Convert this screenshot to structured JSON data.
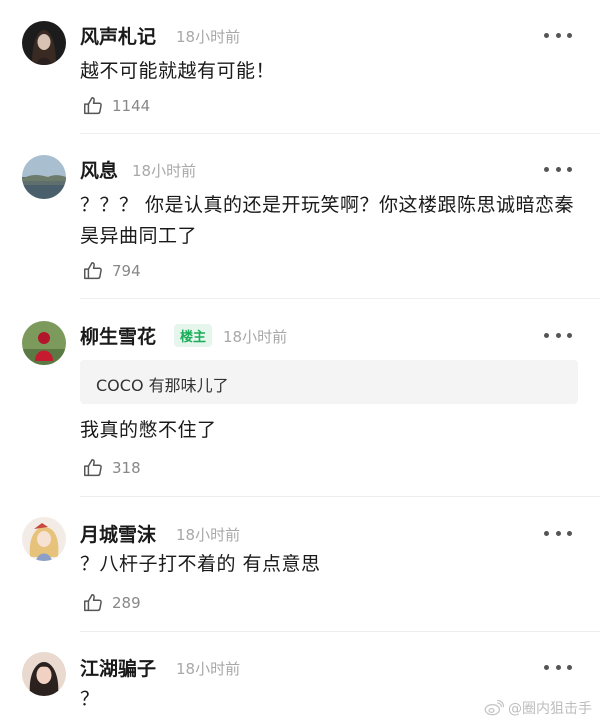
{
  "comments": [
    {
      "user": "风声札记",
      "time": "18小时前",
      "text": "越不可能就越有可能！",
      "likes": "1144"
    },
    {
      "user": "风息",
      "time": "18小时前",
      "text": "？？？ 你是认真的还是开玩笑啊？你这楼跟陈思诚暗恋秦昊异曲同工了",
      "likes": "794"
    },
    {
      "user": "柳生雪花",
      "badge": "楼主",
      "time": "18小时前",
      "quote": "COCO 有那味儿了",
      "text": "我真的憋不住了",
      "likes": "318"
    },
    {
      "user": "月城雪沫",
      "time": "18小时前",
      "text": "？八杆子打不着的 有点意思",
      "likes": "289"
    },
    {
      "user": "江湖骗子",
      "time": "18小时前",
      "text": "？"
    }
  ],
  "watermark": "@圈内狙击手",
  "icons": {
    "more": "more-dots-icon",
    "like": "thumbs-up-icon",
    "watermark": "weibo-logo-icon"
  },
  "colors": {
    "badge_text": "#1aad5a",
    "badge_bg": "#e6f6ec",
    "meta": "#a8a8a8"
  }
}
